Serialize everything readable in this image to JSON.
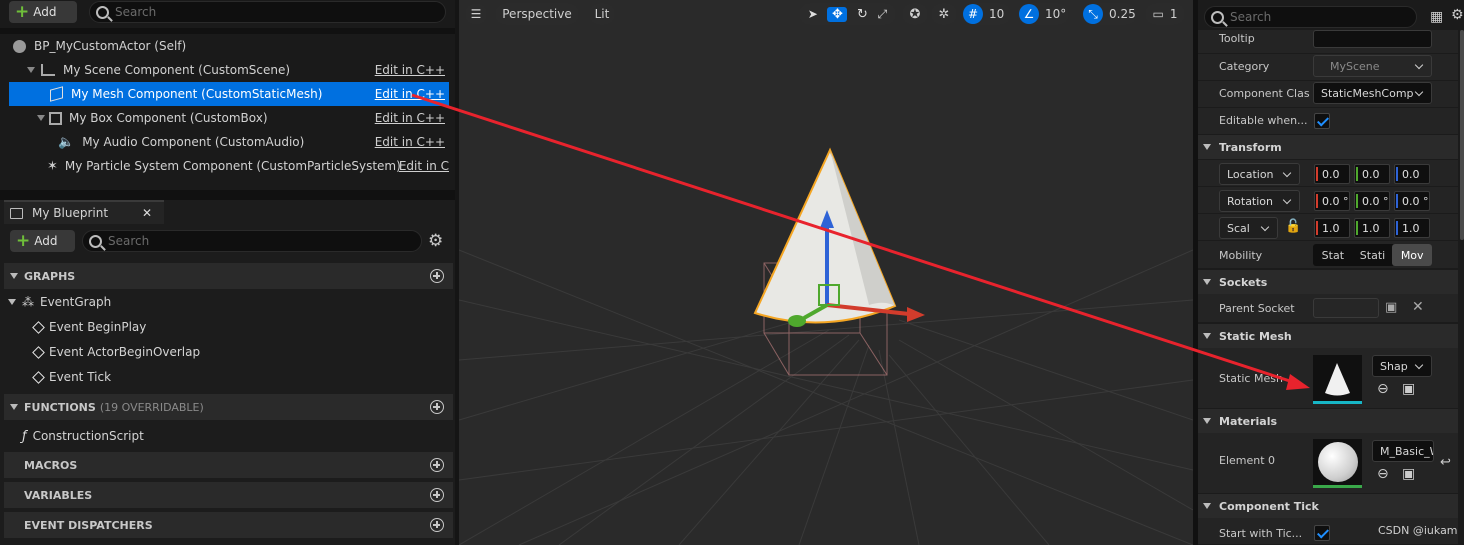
{
  "components_panel": {
    "add_label": "Add",
    "search_placeholder": "Search",
    "edit_cpp_label": "Edit in C++",
    "edit_cpp_label_truncated": "Edit in C",
    "items": [
      {
        "label": "BP_MyCustomActor (Self)"
      },
      {
        "label": "My Scene Component (CustomScene)"
      },
      {
        "label": "My Mesh Component (CustomStaticMesh)"
      },
      {
        "label": "My Box Component (CustomBox)"
      },
      {
        "label": "My Audio Component (CustomAudio)"
      },
      {
        "label": "My Particle System Component (CustomParticleSystem)"
      }
    ]
  },
  "my_blueprint": {
    "tab_label": "My Blueprint",
    "add_label": "Add",
    "search_placeholder": "Search",
    "graphs_header": "GRAPHS",
    "event_graph": "EventGraph",
    "events": [
      "Event BeginPlay",
      "Event ActorBeginOverlap",
      "Event Tick"
    ],
    "functions_header": "FUNCTIONS",
    "functions_sub": "(19 OVERRIDABLE)",
    "construction_script": "ConstructionScript",
    "macros_header": "MACROS",
    "variables_header": "VARIABLES",
    "dispatchers_header": "EVENT DISPATCHERS"
  },
  "viewport": {
    "perspective_label": "Perspective",
    "lit_label": "Lit",
    "grid_snap": "10",
    "rotation_snap": "10°",
    "scale_snap": "0.25",
    "camera_speed": "1"
  },
  "details": {
    "search_placeholder": "Search",
    "tooltip_label": "Tooltip",
    "category_label": "Category",
    "category_value": "MyScene",
    "component_class_label": "Component Clas",
    "component_class_value": "StaticMeshComp",
    "editable_label": "Editable when...",
    "transform_header": "Transform",
    "location_label": "Location",
    "rotation_label": "Rotation",
    "scale_label": "Scal",
    "location": [
      "0.0",
      "0.0",
      "0.0"
    ],
    "rotation": [
      "0.0 °",
      "0.0 °",
      "0.0 °"
    ],
    "scale": [
      "1.0",
      "1.0",
      "1.0"
    ],
    "mobility_label": "Mobility",
    "mobility_options": [
      "Stat",
      "Stati",
      "Mov"
    ],
    "sockets_header": "Sockets",
    "parent_socket_label": "Parent Socket",
    "static_mesh_header": "Static Mesh",
    "static_mesh_label": "Static Mesh",
    "static_mesh_value": "Shap",
    "materials_header": "Materials",
    "element0_label": "Element 0",
    "element0_value": "M_Basic_W",
    "component_tick_header": "Component Tick",
    "start_with_tick_label": "Start with Tic..."
  },
  "watermark": "CSDN @iukam",
  "colors": {
    "selection": "#0070e0",
    "arrow": "#e8232d",
    "x_axis": "#d23c2c",
    "y_axis": "#4fa82d",
    "z_axis": "#2e63d6"
  }
}
